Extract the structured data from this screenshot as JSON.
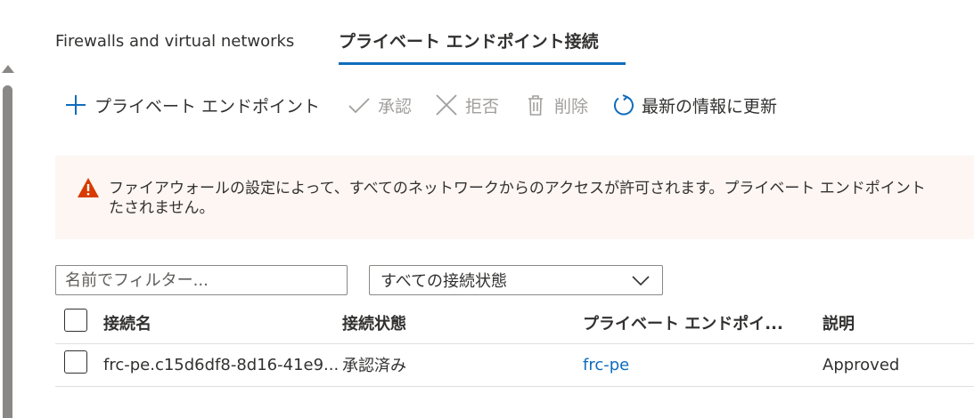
{
  "tabs": [
    {
      "label": "Firewalls and virtual networks",
      "active": false
    },
    {
      "label": "プライベート エンドポイント接続",
      "active": true
    }
  ],
  "toolbar": {
    "add_label": "プライベート エンドポイント",
    "approve_label": "承認",
    "reject_label": "拒否",
    "delete_label": "削除",
    "refresh_label": "最新の情報に更新"
  },
  "banner": {
    "type": "warning",
    "text": "ファイアウォールの設定によって、すべてのネットワークからのアクセスが許可されます。プライベート エンドポイント\nたされません。"
  },
  "filter": {
    "placeholder": "名前でフィルター...",
    "value": ""
  },
  "state_select": {
    "value": "すべての接続状態"
  },
  "table": {
    "headers": {
      "name": "接続名",
      "state": "接続状態",
      "endpoint": "プライベート エンドポイ...",
      "description": "説明"
    },
    "rows": [
      {
        "name": "frc-pe.c15d6df8-8d16-41e9...",
        "state": "承認済み",
        "endpoint": "frc-pe",
        "description": "Approved"
      }
    ]
  },
  "colors": {
    "accent": "#0f6cbd",
    "warning_icon": "#d83b01",
    "banner_bg": "#fdf6f3",
    "disabled_text": "#a19f9d"
  },
  "icons": {
    "add": "plus-icon",
    "approve": "checkmark-icon",
    "reject": "close-icon",
    "delete": "trash-icon",
    "refresh": "refresh-icon",
    "warning": "warning-icon",
    "select": "chevron-down-icon"
  }
}
